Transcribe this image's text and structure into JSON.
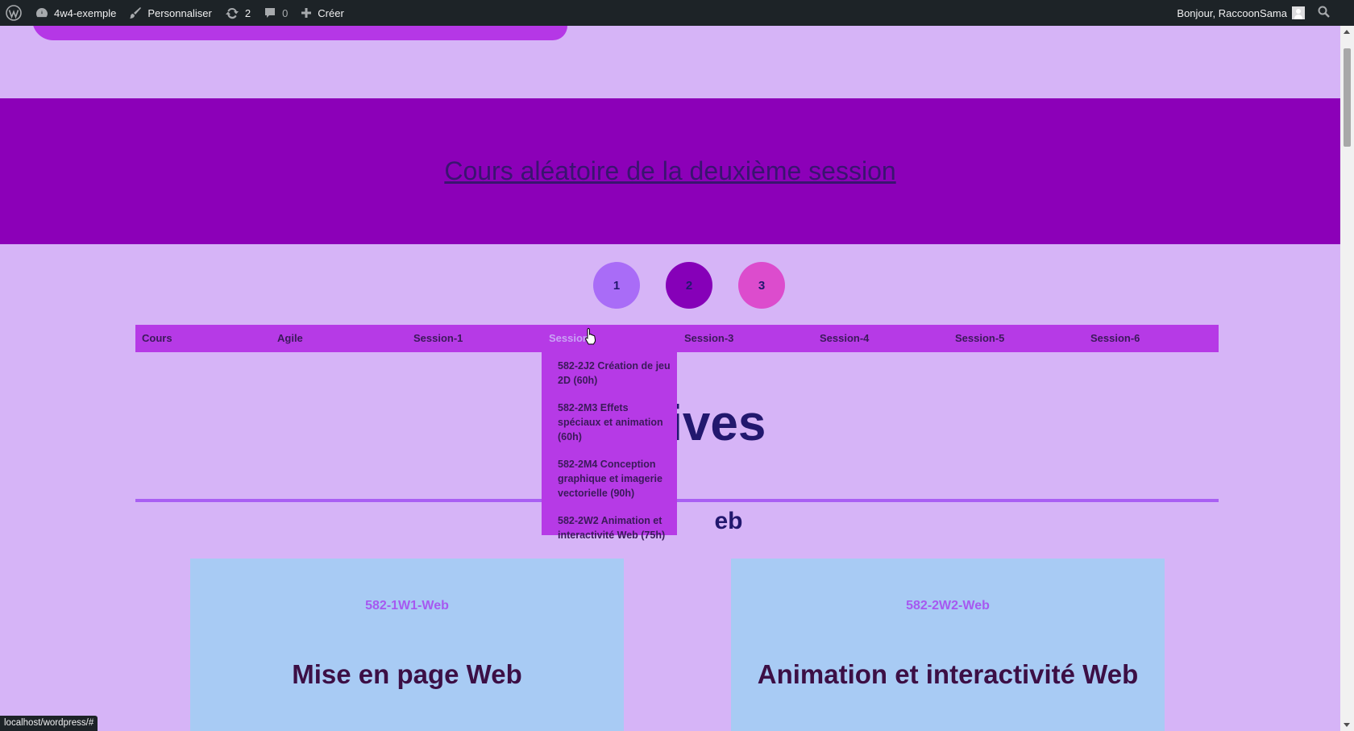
{
  "admin_bar": {
    "site_name": "4w4-exemple",
    "customize": "Personnaliser",
    "updates_count": "2",
    "comments_count": "0",
    "new": "Créer",
    "greeting": "Bonjour, RaccoonSama"
  },
  "banner": {
    "link": "Cours aléatoire de la deuxième session"
  },
  "pager": {
    "pages": [
      "1",
      "2",
      "3"
    ]
  },
  "nav": {
    "items": [
      "Cours",
      "Agile",
      "Session-1",
      "Session-2",
      "Session-3",
      "Session-4",
      "Session-5",
      "Session-6"
    ],
    "active_visible_text": "Session",
    "dropdown": [
      "582-2J2 Création de jeu 2D (60h)",
      "582-2M3 Effets spéciaux et animation (60h)",
      "582-2M4 Conception graphique et imagerie vectorielle (90h)",
      "582-2W2 Animation et interactivité Web (75h)"
    ]
  },
  "archive": {
    "title_visible": "ives",
    "section_visible": "eb"
  },
  "cards": [
    {
      "code": "582-1W1-Web",
      "title": "Mise en page Web"
    },
    {
      "code": "582-2W2-Web",
      "title": "Animation et interactivité Web"
    }
  ],
  "status_bar": {
    "url": "localhost/wordpress/#"
  },
  "colors": {
    "page_bg": "#d6b4f7",
    "banner_bg": "#8c00b8",
    "menu_bg": "#b63ae6",
    "circle_1": "#a96cf7",
    "circle_2": "#8600b8",
    "circle_3": "#dc4ccd",
    "card_bg": "#a8cbf4",
    "heading": "#22186e"
  }
}
